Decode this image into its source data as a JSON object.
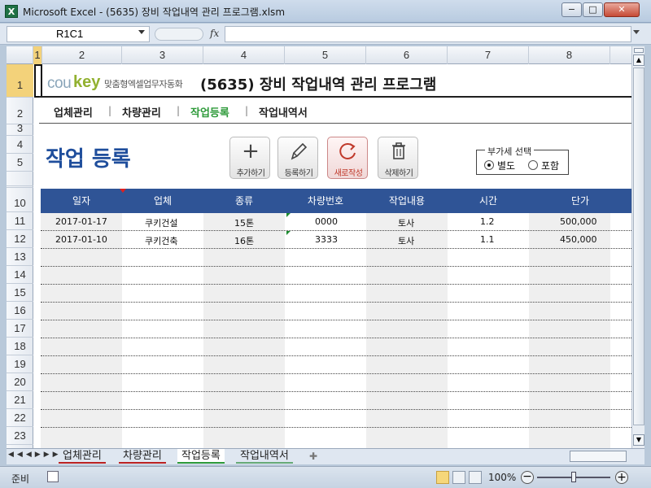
{
  "window": {
    "app_icon": "X",
    "title": "Microsoft Excel - (5635) 장비 작업내역 관리 프로그램.xlsm",
    "minimize": "−",
    "maximize": "□",
    "close": "✕"
  },
  "formula_bar": {
    "name_box": "R1C1",
    "fx": "fx",
    "value": ""
  },
  "columns": [
    "1",
    "2",
    "3",
    "4",
    "5",
    "6",
    "7",
    "8"
  ],
  "rows": [
    "1",
    "2",
    "3",
    "4",
    "5",
    "10",
    "11",
    "12",
    "13",
    "14",
    "15",
    "16",
    "17",
    "18",
    "19",
    "20",
    "21",
    "22",
    "23"
  ],
  "logo": {
    "co": "cou",
    "key": "key",
    "tagline": "맞춤형엑셀업무자동화"
  },
  "app_title": "(5635) 장비 작업내역 관리 프로그램",
  "nav": {
    "items": [
      "업체관리",
      "차량관리",
      "작업등록",
      "작업내역서"
    ],
    "separator": "|",
    "active_color": "#2e9a3a"
  },
  "page_heading": "작업 등록",
  "toolbar": {
    "add": {
      "label": "추가하기",
      "icon": "plus-icon"
    },
    "register": {
      "label": "등록하기",
      "icon": "pencil-icon"
    },
    "refresh": {
      "label": "새로작성",
      "icon": "refresh-icon"
    },
    "delete": {
      "label": "삭제하기",
      "icon": "trash-icon"
    }
  },
  "vat": {
    "legend": "부가세 선택",
    "options": [
      "별도",
      "포함"
    ],
    "selected": "별도"
  },
  "table": {
    "header_color": "#2f5496",
    "columns": [
      "일자",
      "업체",
      "종류",
      "차량번호",
      "작업내용",
      "시간",
      "단가"
    ],
    "rows": [
      [
        "2017-01-17",
        "쿠키건설",
        "15톤",
        "0000",
        "토사",
        "1.2",
        "500,000"
      ],
      [
        "2017-01-10",
        "쿠키건축",
        "16톤",
        "3333",
        "토사",
        "1.1",
        "450,000"
      ]
    ]
  },
  "sheet_tabs": [
    "업체관리",
    "차량관리",
    "작업등록",
    "작업내역서"
  ],
  "active_sheet": "작업등록",
  "status": {
    "ready": "준비",
    "zoom": "100%"
  }
}
